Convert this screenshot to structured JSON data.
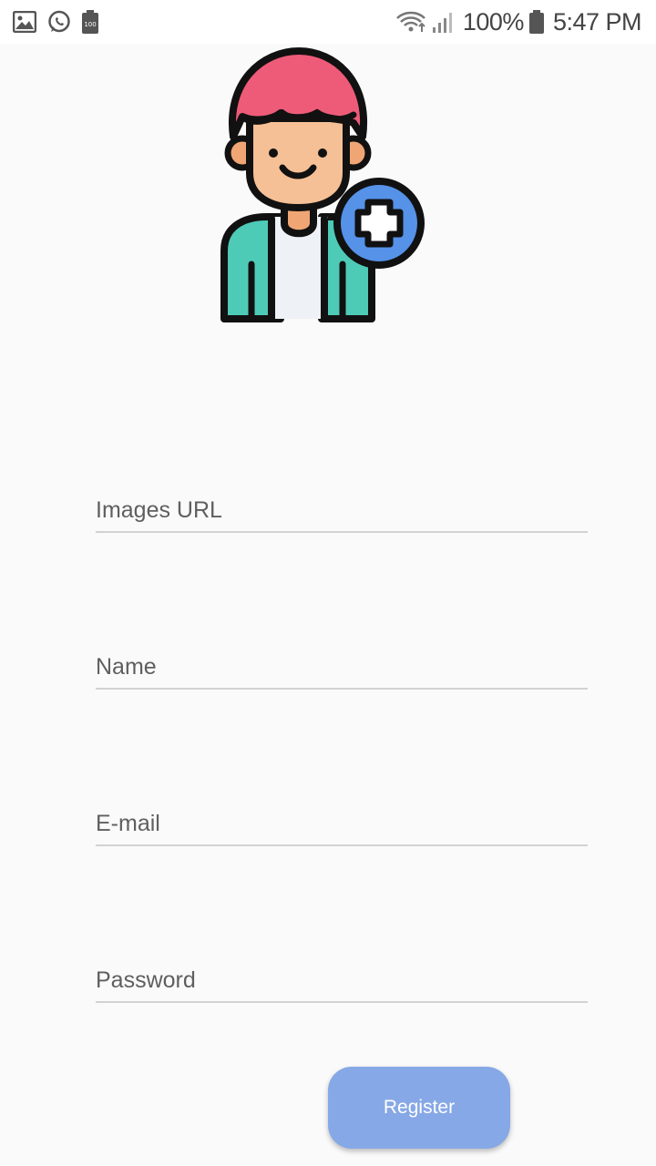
{
  "status_bar": {
    "battery_percent": "100%",
    "time": "5:47 PM",
    "icons": [
      "gallery-icon",
      "whatsapp-icon",
      "battery-saver-icon",
      "wifi-icon",
      "signal-icon",
      "battery-icon"
    ],
    "saver_badge": "100"
  },
  "form": {
    "image_url_placeholder": "Images URL",
    "name_placeholder": "Name",
    "email_placeholder": "E-mail",
    "password_placeholder": "Password",
    "register_label": "Register"
  },
  "colors": {
    "accent_button": "#87a8e6",
    "hair": "#ee5b78",
    "skin": "#f5c096",
    "jacket": "#4ecbb7",
    "plus_badge": "#5592e8"
  }
}
